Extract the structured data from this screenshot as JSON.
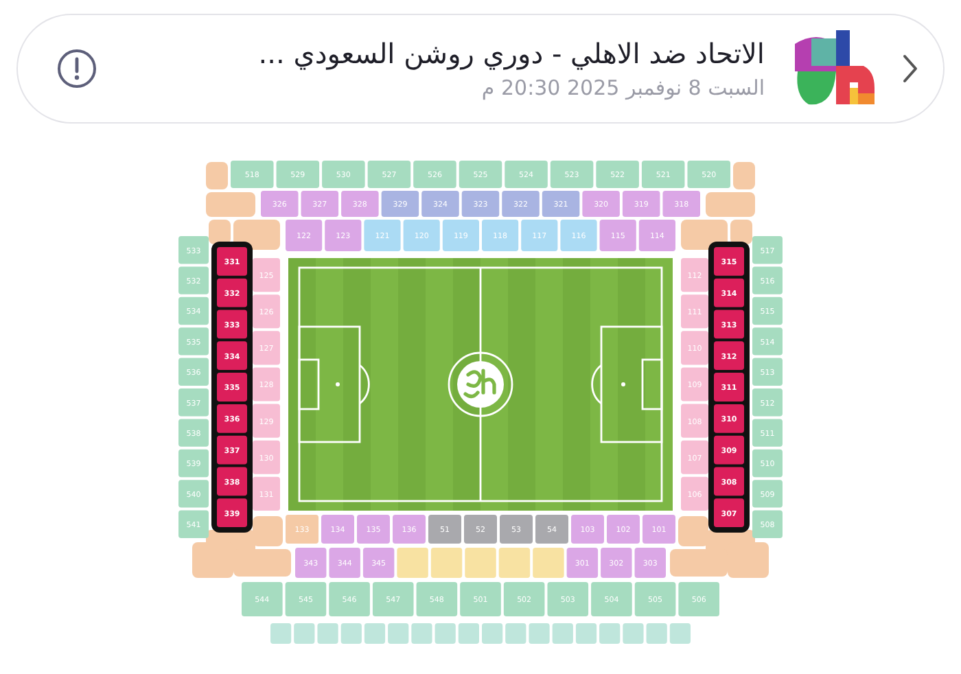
{
  "header": {
    "title": "الاتحاد ضد الاهلي - دوري روشن السعودي ...",
    "date": "السبت 8 نوفمبر 2025 20:30 م"
  },
  "map": {
    "top_outer": [
      {
        "label": "518",
        "kind": "upper"
      },
      {
        "label": "529",
        "kind": "upper"
      },
      {
        "label": "530",
        "kind": "upper"
      },
      {
        "label": "527",
        "kind": "upper"
      },
      {
        "label": "526",
        "kind": "upper"
      },
      {
        "label": "525",
        "kind": "upper"
      },
      {
        "label": "524",
        "kind": "upper"
      },
      {
        "label": "523",
        "kind": "upper"
      },
      {
        "label": "522",
        "kind": "upper"
      },
      {
        "label": "521",
        "kind": "upper"
      },
      {
        "label": "520",
        "kind": "upper"
      }
    ],
    "top_middle": [
      {
        "label": "326",
        "kind": "purple"
      },
      {
        "label": "327",
        "kind": "purple"
      },
      {
        "label": "328",
        "kind": "purple"
      },
      {
        "label": "329",
        "kind": "slate"
      },
      {
        "label": "324",
        "kind": "slate"
      },
      {
        "label": "323",
        "kind": "slate"
      },
      {
        "label": "322",
        "kind": "slate"
      },
      {
        "label": "321",
        "kind": "slate"
      },
      {
        "label": "320",
        "kind": "purple"
      },
      {
        "label": "319",
        "kind": "purple"
      },
      {
        "label": "318",
        "kind": "purple"
      }
    ],
    "top_inner": [
      {
        "label": "122",
        "kind": "purple"
      },
      {
        "label": "123",
        "kind": "purple"
      },
      {
        "label": "121",
        "kind": "blue"
      },
      {
        "label": "120",
        "kind": "blue"
      },
      {
        "label": "119",
        "kind": "blue"
      },
      {
        "label": "118",
        "kind": "blue"
      },
      {
        "label": "117",
        "kind": "blue"
      },
      {
        "label": "116",
        "kind": "blue"
      },
      {
        "label": "115",
        "kind": "purple"
      },
      {
        "label": "114",
        "kind": "purple"
      }
    ],
    "left_outer": [
      {
        "label": "533",
        "kind": "upper"
      },
      {
        "label": "532",
        "kind": "upper"
      },
      {
        "label": "534",
        "kind": "upper"
      },
      {
        "label": "535",
        "kind": "upper"
      },
      {
        "label": "536",
        "kind": "upper"
      },
      {
        "label": "537",
        "kind": "upper"
      },
      {
        "label": "538",
        "kind": "upper"
      },
      {
        "label": "539",
        "kind": "upper"
      },
      {
        "label": "540",
        "kind": "upper"
      },
      {
        "label": "541",
        "kind": "upper"
      }
    ],
    "left_selected": [
      {
        "label": "331",
        "selected": true
      },
      {
        "label": "332",
        "selected": true
      },
      {
        "label": "333",
        "selected": true
      },
      {
        "label": "334",
        "selected": true
      },
      {
        "label": "335",
        "selected": true
      },
      {
        "label": "336",
        "selected": true
      },
      {
        "label": "337",
        "selected": true
      },
      {
        "label": "338",
        "selected": true
      },
      {
        "label": "339",
        "selected": true
      }
    ],
    "left_inner": [
      {
        "label": "125",
        "kind": "pink"
      },
      {
        "label": "126",
        "kind": "pink"
      },
      {
        "label": "127",
        "kind": "pink"
      },
      {
        "label": "128",
        "kind": "pink"
      },
      {
        "label": "129",
        "kind": "pink"
      },
      {
        "label": "130",
        "kind": "pink"
      },
      {
        "label": "131",
        "kind": "pink"
      }
    ],
    "right_inner": [
      {
        "label": "112",
        "kind": "pink"
      },
      {
        "label": "111",
        "kind": "pink"
      },
      {
        "label": "110",
        "kind": "pink"
      },
      {
        "label": "109",
        "kind": "pink"
      },
      {
        "label": "108",
        "kind": "pink"
      },
      {
        "label": "107",
        "kind": "pink"
      },
      {
        "label": "106",
        "kind": "pink"
      }
    ],
    "right_selected": [
      {
        "label": "315",
        "selected": true
      },
      {
        "label": "314",
        "selected": true
      },
      {
        "label": "313",
        "selected": true
      },
      {
        "label": "312",
        "selected": true
      },
      {
        "label": "311",
        "selected": true
      },
      {
        "label": "310",
        "selected": true
      },
      {
        "label": "309",
        "selected": true
      },
      {
        "label": "308",
        "selected": true
      },
      {
        "label": "307",
        "selected": true
      }
    ],
    "right_outer": [
      {
        "label": "517",
        "kind": "upper"
      },
      {
        "label": "516",
        "kind": "upper"
      },
      {
        "label": "515",
        "kind": "upper"
      },
      {
        "label": "514",
        "kind": "upper"
      },
      {
        "label": "513",
        "kind": "upper"
      },
      {
        "label": "512",
        "kind": "upper"
      },
      {
        "label": "511",
        "kind": "upper"
      },
      {
        "label": "510",
        "kind": "upper"
      },
      {
        "label": "509",
        "kind": "upper"
      },
      {
        "label": "508",
        "kind": "upper"
      }
    ],
    "bottom_inner": [
      {
        "label": "133",
        "kind": "orange"
      },
      {
        "label": "134",
        "kind": "purple"
      },
      {
        "label": "135",
        "kind": "purple"
      },
      {
        "label": "136",
        "kind": "purple"
      },
      {
        "label": "51",
        "kind": "grey"
      },
      {
        "label": "52",
        "kind": "grey"
      },
      {
        "label": "53",
        "kind": "grey"
      },
      {
        "label": "54",
        "kind": "grey"
      },
      {
        "label": "103",
        "kind": "purple"
      },
      {
        "label": "102",
        "kind": "purple"
      },
      {
        "label": "101",
        "kind": "purple"
      }
    ],
    "bottom_middle": [
      {
        "label": "343",
        "kind": "purple"
      },
      {
        "label": "344",
        "kind": "purple"
      },
      {
        "label": "345",
        "kind": "purple"
      },
      {
        "kind": "yellow"
      },
      {
        "kind": "yellow"
      },
      {
        "kind": "yellow"
      },
      {
        "kind": "yellow"
      },
      {
        "kind": "yellow"
      },
      {
        "label": "301",
        "kind": "purple"
      },
      {
        "label": "302",
        "kind": "purple"
      },
      {
        "label": "303",
        "kind": "purple"
      }
    ],
    "bottom_outer": [
      {
        "label": "544",
        "kind": "upper"
      },
      {
        "label": "545",
        "kind": "upper"
      },
      {
        "label": "546",
        "kind": "upper"
      },
      {
        "label": "547",
        "kind": "upper"
      },
      {
        "label": "548",
        "kind": "upper"
      },
      {
        "label": "501",
        "kind": "upper"
      },
      {
        "label": "502",
        "kind": "upper"
      },
      {
        "label": "503",
        "kind": "upper"
      },
      {
        "label": "504",
        "kind": "upper"
      },
      {
        "label": "505",
        "kind": "upper"
      },
      {
        "label": "506",
        "kind": "upper"
      }
    ],
    "gate_row": [
      {
        "kind": "gate"
      },
      {
        "kind": "gate"
      },
      {
        "kind": "gate"
      },
      {
        "kind": "gate"
      },
      {
        "kind": "gate"
      },
      {
        "kind": "gate"
      },
      {
        "kind": "gate"
      },
      {
        "kind": "gate"
      },
      {
        "kind": "gate"
      },
      {
        "kind": "gate"
      },
      {
        "kind": "gate"
      },
      {
        "kind": "gate"
      },
      {
        "kind": "gate"
      },
      {
        "kind": "gate"
      },
      {
        "kind": "gate"
      },
      {
        "kind": "gate"
      },
      {
        "kind": "gate"
      },
      {
        "kind": "gate"
      }
    ]
  }
}
